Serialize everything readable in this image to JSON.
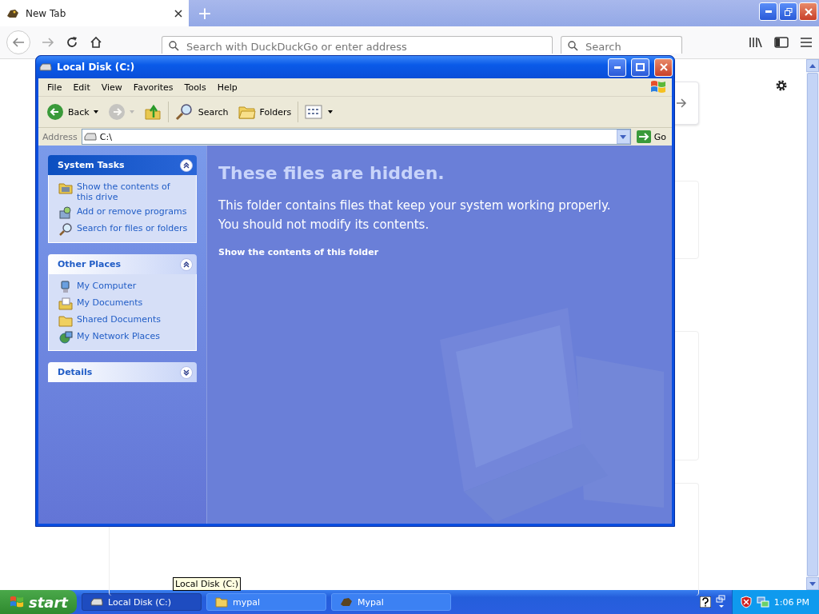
{
  "browser": {
    "tabs": [
      {
        "label": "New Tab",
        "selected": true
      }
    ],
    "new_tab": "+",
    "address": {
      "placeholder": "Search with DuckDuckGo or enter address"
    },
    "search": {
      "placeholder": "Search"
    }
  },
  "explorer": {
    "title": "Local Disk (C:)",
    "menu": [
      "File",
      "Edit",
      "View",
      "Favorites",
      "Tools",
      "Help"
    ],
    "toolbar": [
      {
        "kind": "back",
        "label": "Back",
        "disabled": false
      },
      {
        "kind": "forward",
        "disabled": true
      },
      {
        "kind": "up",
        "disabled": false
      },
      {
        "kind": "search",
        "label": "Search",
        "disabled": false
      },
      {
        "kind": "folders",
        "label": "Folders",
        "disabled": false
      },
      {
        "kind": "views",
        "disabled": false
      }
    ],
    "address": {
      "label": "Address",
      "value": "C:\\",
      "go": "Go"
    },
    "panels": [
      {
        "title": "System Tasks",
        "kind": "special",
        "expanded": true,
        "items": [
          {
            "kind": "drive",
            "label": "Show the contents of this drive"
          },
          {
            "kind": "programs",
            "label": "Add or remove programs"
          },
          {
            "kind": "search",
            "label": "Search for files or folders"
          }
        ]
      },
      {
        "title": "Other Places",
        "kind": "normal",
        "expanded": true,
        "items": [
          {
            "kind": "computer",
            "label": "My Computer"
          },
          {
            "kind": "documents",
            "label": "My Documents"
          },
          {
            "kind": "folder",
            "label": "Shared Documents"
          },
          {
            "kind": "network",
            "label": "My Network Places"
          }
        ]
      },
      {
        "title": "Details",
        "kind": "normal",
        "expanded": false
      }
    ],
    "heading": "These files are hidden.",
    "message": "This folder contains files that keep your system working properly. You should not modify its contents.",
    "link": "Show the contents of this folder"
  },
  "taskbar": {
    "start": "start",
    "tasks": [
      {
        "kind": "drive",
        "label": "Local Disk (C:)",
        "selected": true
      },
      {
        "kind": "folder",
        "label": "mypal",
        "selected": false
      },
      {
        "kind": "app",
        "label": "Mypal",
        "selected": false
      }
    ],
    "tooltip": "Local Disk (C:)",
    "clock": "1:06 PM"
  }
}
